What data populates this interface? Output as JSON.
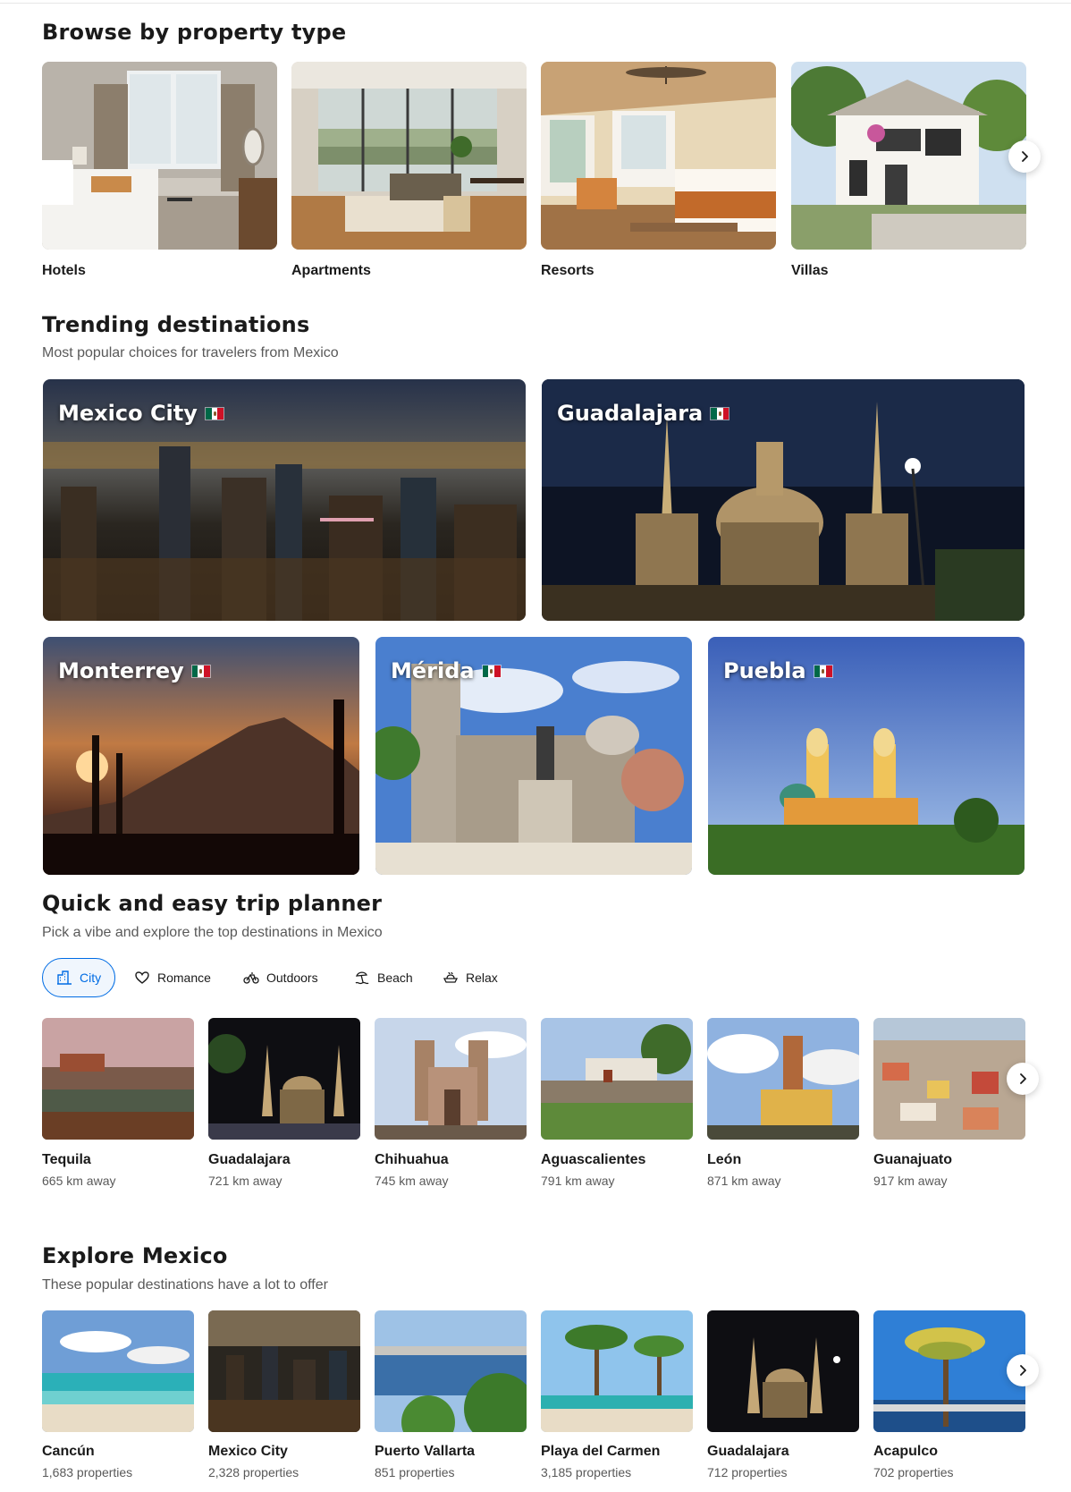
{
  "property_types": {
    "heading": "Browse by property type",
    "items": [
      {
        "label": "Hotels"
      },
      {
        "label": "Apartments"
      },
      {
        "label": "Resorts"
      },
      {
        "label": "Villas"
      }
    ],
    "next_icon": "chevron-right-icon"
  },
  "trending": {
    "heading": "Trending destinations",
    "subtitle": "Most popular choices for travelers from Mexico",
    "items": [
      {
        "name": "Mexico City",
        "flag": "mexico-flag-icon"
      },
      {
        "name": "Guadalajara",
        "flag": "mexico-flag-icon"
      },
      {
        "name": "Monterrey",
        "flag": "mexico-flag-icon"
      },
      {
        "name": "Mérida",
        "flag": "mexico-flag-icon"
      },
      {
        "name": "Puebla",
        "flag": "mexico-flag-icon"
      }
    ]
  },
  "trip_planner": {
    "heading": "Quick and easy trip planner",
    "subtitle": "Pick a vibe and explore the top destinations in Mexico",
    "tabs": [
      {
        "label": "City",
        "icon": "city-icon",
        "active": true
      },
      {
        "label": "Romance",
        "icon": "heart-icon",
        "active": false
      },
      {
        "label": "Outdoors",
        "icon": "bicycle-icon",
        "active": false
      },
      {
        "label": "Beach",
        "icon": "beach-icon",
        "active": false
      },
      {
        "label": "Relax",
        "icon": "relax-icon",
        "active": false
      }
    ],
    "items": [
      {
        "name": "Tequila",
        "meta": "665 km away"
      },
      {
        "name": "Guadalajara",
        "meta": "721 km away"
      },
      {
        "name": "Chihuahua",
        "meta": "745 km away"
      },
      {
        "name": "Aguascalientes",
        "meta": "791 km away"
      },
      {
        "name": "León",
        "meta": "871 km away"
      },
      {
        "name": "Guanajuato",
        "meta": "917 km away"
      }
    ]
  },
  "explore": {
    "heading": "Explore Mexico",
    "subtitle": "These popular destinations have a lot to offer",
    "items": [
      {
        "name": "Cancún",
        "meta": "1,683 properties"
      },
      {
        "name": "Mexico City",
        "meta": "2,328 properties"
      },
      {
        "name": "Puerto Vallarta",
        "meta": "851 properties"
      },
      {
        "name": "Playa del Carmen",
        "meta": "3,185 properties"
      },
      {
        "name": "Guadalajara",
        "meta": "712 properties"
      },
      {
        "name": "Acapulco",
        "meta": "702 properties"
      }
    ]
  },
  "colors": {
    "accent": "#006ce4",
    "text": "#1a1a1a",
    "muted": "#595959"
  }
}
